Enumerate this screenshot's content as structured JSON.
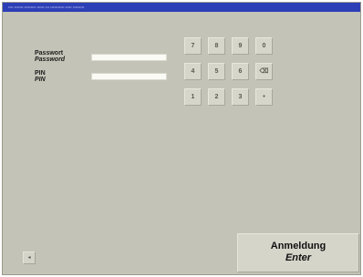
{
  "title_bar": {
    "text": "•••• ••••••• ••••••••• •••••• ••• ••••••••••• ••••• •••••••••"
  },
  "form": {
    "password_label_de": "Passwort",
    "password_label_en": "Password",
    "pin_label_de": "PIN",
    "pin_label_en": "PIN",
    "password_value": "",
    "pin_value": ""
  },
  "keypad": {
    "keys": [
      "7",
      "8",
      "9",
      "0",
      "4",
      "5",
      "6",
      "⌫",
      "1",
      "2",
      "3",
      "•"
    ]
  },
  "enter_button": {
    "label_de": "Anmeldung",
    "label_en": "Enter"
  },
  "small_button": {
    "label": "◂"
  }
}
